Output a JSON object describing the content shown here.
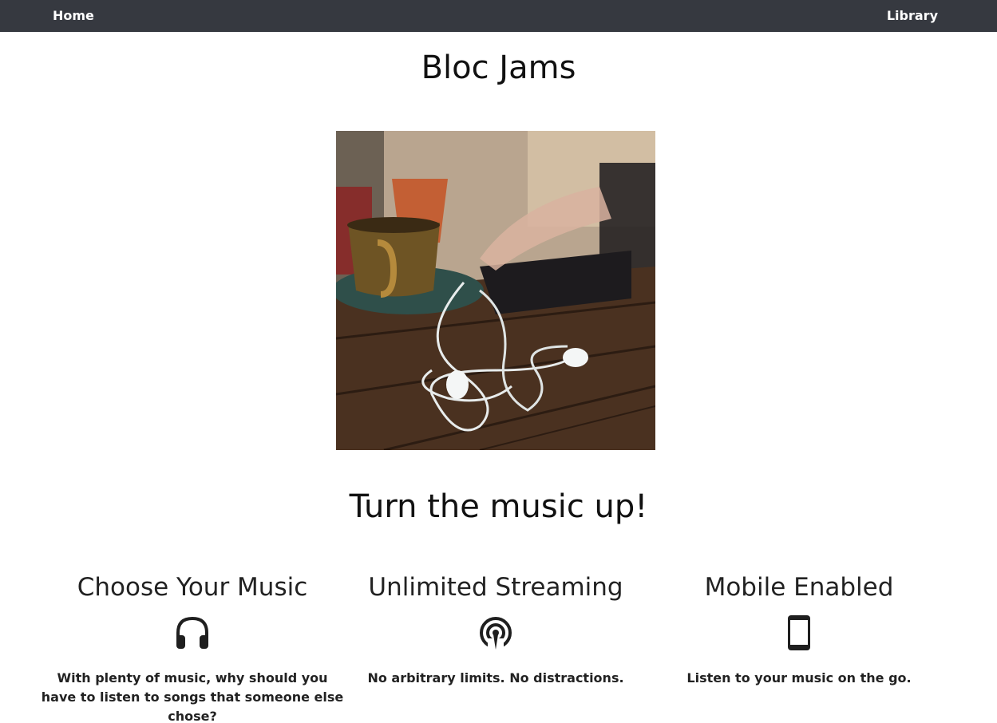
{
  "nav": {
    "home_label": "Home",
    "library_label": "Library",
    "background": "#363940"
  },
  "hero": {
    "title": "Bloc Jams",
    "image_alt": "Earphones on a wooden table next to a coffee cup"
  },
  "tagline": "Turn the music up!",
  "features": [
    {
      "title": "Choose Your Music",
      "icon": "headphones-icon",
      "description": "With plenty of music, why should you have to listen to songs that someone else chose?"
    },
    {
      "title": "Unlimited Streaming",
      "icon": "broadcast-icon",
      "description": "No arbitrary limits. No distractions."
    },
    {
      "title": "Mobile Enabled",
      "icon": "mobile-phone-icon",
      "description": "Listen to your music on the go."
    }
  ]
}
